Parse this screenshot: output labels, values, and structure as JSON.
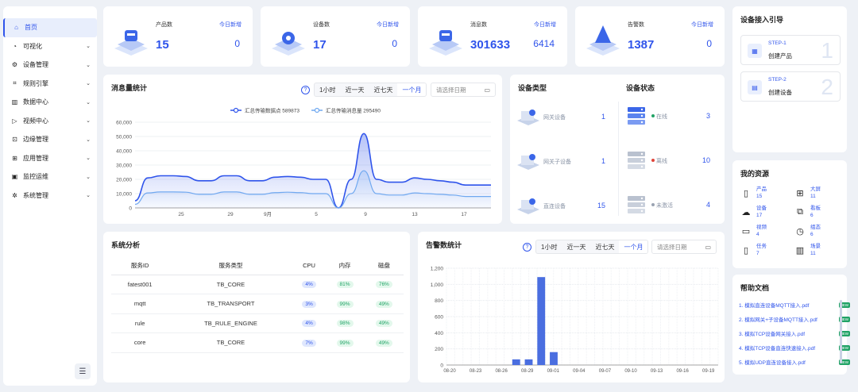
{
  "sidebar": {
    "items": [
      {
        "label": "首页",
        "icon": "home-icon",
        "active": true
      },
      {
        "label": "可视化",
        "icon": "dashboard-icon"
      },
      {
        "label": "设备管理",
        "icon": "device-icon"
      },
      {
        "label": "规则引擎",
        "icon": "rule-icon"
      },
      {
        "label": "数据中心",
        "icon": "data-icon"
      },
      {
        "label": "视频中心",
        "icon": "video-icon"
      },
      {
        "label": "边缘管理",
        "icon": "edge-icon"
      },
      {
        "label": "应用管理",
        "icon": "app-icon"
      },
      {
        "label": "监控运维",
        "icon": "monitor-icon"
      },
      {
        "label": "系统管理",
        "icon": "settings-icon"
      }
    ]
  },
  "stats": [
    {
      "label": "产品数",
      "value": "15",
      "today_label": "今日新增",
      "today_value": "0"
    },
    {
      "label": "设备数",
      "value": "17",
      "today_label": "今日新增",
      "today_value": "0"
    },
    {
      "label": "消息数",
      "value": "301633",
      "today_label": "今日新增",
      "today_value": "6414"
    },
    {
      "label": "告警数",
      "value": "1387",
      "today_label": "今日新增",
      "today_value": "0"
    }
  ],
  "message_panel": {
    "title": "消息量统计",
    "ranges": [
      "1小时",
      "近一天",
      "近七天",
      "一个月"
    ],
    "active_range": "一个月",
    "date_placeholder": "请选择日期"
  },
  "alarm_panel": {
    "title": "告警数统计",
    "ranges": [
      "1小时",
      "近一天",
      "近七天",
      "一个月"
    ],
    "active_range": "一个月",
    "date_placeholder": "请选择日期"
  },
  "device_types": {
    "title": "设备类型",
    "items": [
      {
        "label": "网关设备",
        "count": "1"
      },
      {
        "label": "网关子设备",
        "count": "1"
      },
      {
        "label": "直连设备",
        "count": "15"
      }
    ]
  },
  "device_status": {
    "title": "设备状态",
    "items": [
      {
        "label": "在线",
        "count": "3",
        "color": "#21a366"
      },
      {
        "label": "离线",
        "count": "10",
        "color": "#e0453a"
      },
      {
        "label": "未激活",
        "count": "4",
        "color": "#9aa3b2"
      }
    ]
  },
  "system": {
    "title": "系统分析",
    "headers": [
      "服务ID",
      "服务类型",
      "CPU",
      "内存",
      "磁盘"
    ],
    "rows": [
      {
        "id": "fatest001",
        "type": "TB_CORE",
        "cpu": "4%",
        "mem": "81%",
        "disk": "76%"
      },
      {
        "id": "mqtt",
        "type": "TB_TRANSPORT",
        "cpu": "3%",
        "mem": "99%",
        "disk": "49%"
      },
      {
        "id": "rule",
        "type": "TB_RULE_ENGINE",
        "cpu": "4%",
        "mem": "98%",
        "disk": "49%"
      },
      {
        "id": "core",
        "type": "TB_CORE",
        "cpu": "7%",
        "mem": "99%",
        "disk": "49%"
      }
    ]
  },
  "guide": {
    "title": "设备接入引导",
    "steps": [
      {
        "step": "STEP-1",
        "name": "创建产品",
        "num": "1"
      },
      {
        "step": "STEP-2",
        "name": "创建设备",
        "num": "2"
      }
    ]
  },
  "resources": {
    "title": "我的资源",
    "items": [
      {
        "label": "产品",
        "value": "15",
        "icon": "file-icon"
      },
      {
        "label": "大屏",
        "value": "11",
        "icon": "grid-icon"
      },
      {
        "label": "设备",
        "value": "17",
        "icon": "cloud-icon"
      },
      {
        "label": "看板",
        "value": "6",
        "icon": "hierarchy-icon"
      },
      {
        "label": "视频",
        "value": "4",
        "icon": "camera-icon"
      },
      {
        "label": "组态",
        "value": "6",
        "icon": "gauge-icon"
      },
      {
        "label": "任务",
        "value": "7",
        "icon": "phone-icon"
      },
      {
        "label": "场景",
        "value": "11",
        "icon": "bar-chart-icon"
      }
    ]
  },
  "docs": {
    "title": "帮助文档",
    "items": [
      "1. 模拟直连设备MQTT接入.pdf",
      "2. 模拟网关+子设备MQTT接入.pdf",
      "3. 模拟TCP设备网关接入.pdf",
      "4. 模拟TCP设备直连快速接入.pdf",
      "5. 模拟UDP直连设备接入.pdf"
    ],
    "badge": "NEW"
  },
  "chart_data": [
    {
      "type": "area",
      "title": "消息量统计",
      "legend": [
        "汇总传输数据点 589873",
        "汇总传输消息量 295490"
      ],
      "legend_position": "top-center",
      "ylim": [
        0,
        60000
      ],
      "yticks": [
        "0",
        "10,000",
        "20,000",
        "30,000",
        "40,000",
        "50,000",
        "60,000"
      ],
      "xticks": [
        "25",
        "29",
        "9月",
        "5",
        "9",
        "13",
        "17"
      ],
      "series": [
        {
          "name": "汇总传输数据点 589873",
          "color": "#2f54eb",
          "values": [
            5000,
            21000,
            22500,
            22500,
            22000,
            19000,
            19000,
            22500,
            22500,
            19000,
            19000,
            21500,
            22000,
            21500,
            20000,
            20000,
            0,
            20000,
            52000,
            20000,
            18000,
            18000,
            21000,
            20000,
            19000,
            18000,
            16000,
            16000,
            16000
          ]
        },
        {
          "name": "汇总传输消息量 295490",
          "color": "#6fa8f0",
          "values": [
            2500,
            10500,
            11200,
            11200,
            11000,
            9500,
            9500,
            11200,
            11200,
            9500,
            9500,
            10700,
            11000,
            10700,
            10000,
            10000,
            0,
            10000,
            26000,
            10000,
            9000,
            9000,
            10500,
            10000,
            9500,
            9000,
            8000,
            8000,
            8000
          ]
        }
      ]
    },
    {
      "type": "bar",
      "title": "告警数统计",
      "ylim": [
        0,
        1200
      ],
      "yticks": [
        "0",
        "200",
        "400",
        "600",
        "800",
        "1,000",
        "1,200"
      ],
      "xticks": [
        "08-20",
        "08-23",
        "08-26",
        "08-29",
        "09-01",
        "09-04",
        "09-07",
        "09-10",
        "09-13",
        "09-16",
        "09-19"
      ],
      "values": [
        0,
        0,
        0,
        0,
        0,
        0,
        0,
        0,
        0,
        0,
        0,
        0,
        0,
        0,
        0,
        0,
        0,
        0,
        0,
        0,
        0,
        0,
        0,
        0,
        0,
        0,
        0,
        0,
        0,
        0,
        0,
        0,
        0,
        0,
        0,
        0,
        0,
        0,
        0,
        0,
        0,
        0,
        0,
        0,
        0,
        0,
        0,
        0,
        0,
        0,
        0,
        0,
        0,
        0,
        0,
        0,
        0,
        0,
        0,
        0,
        0,
        0,
        0,
        0,
        0,
        0,
        0,
        0,
        0,
        0,
        0,
        0,
        0,
        0,
        0,
        0,
        0,
        0,
        0,
        0,
        0,
        0,
        0,
        0,
        0,
        0,
        0,
        0,
        0,
        0
      ],
      "bars": [
        {
          "pos": 5.7,
          "value": 70
        },
        {
          "pos": 6.0,
          "value": 70
        },
        {
          "pos": 6.3,
          "value": 1090
        },
        {
          "pos": 6.6,
          "value": 160
        }
      ],
      "color": "#4a6ee0"
    }
  ]
}
